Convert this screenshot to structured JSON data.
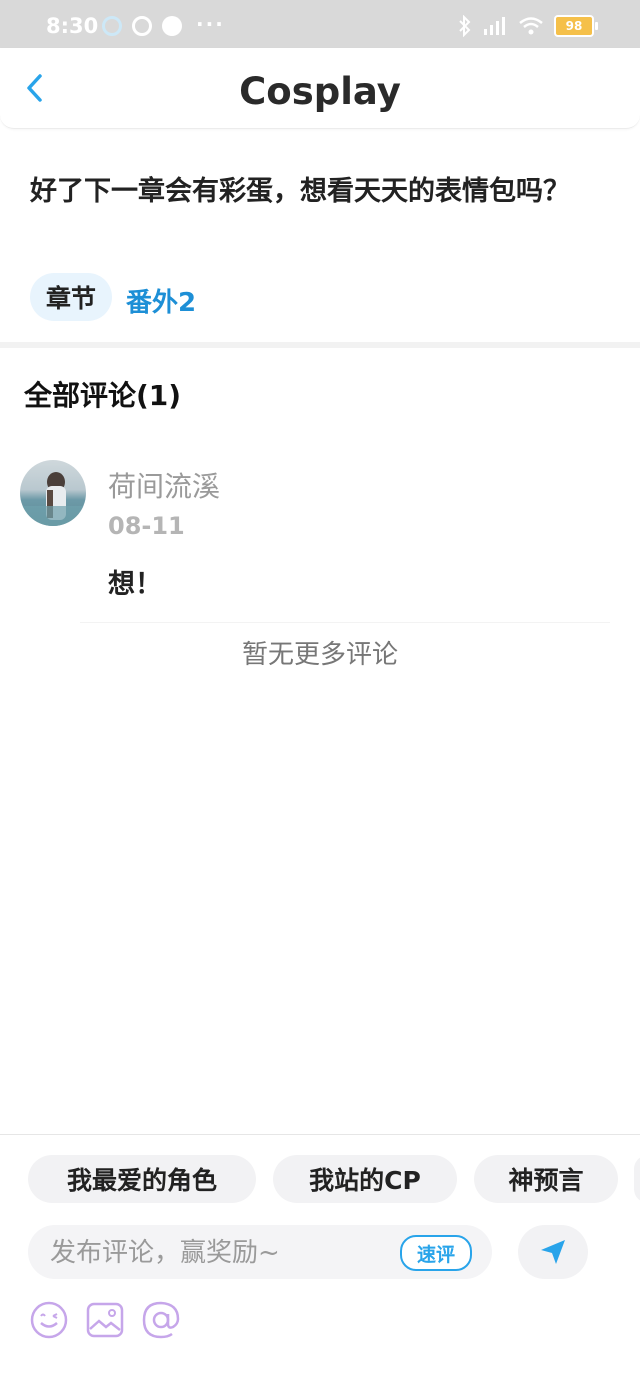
{
  "status_bar": {
    "time": "8:30",
    "dots": "···",
    "battery": "98"
  },
  "header": {
    "title": "Cosplay"
  },
  "post": {
    "text": "好了下一章会有彩蛋，想看天天的表情包吗？",
    "tag_label": "章节",
    "chapter_name": "番外2"
  },
  "comments": {
    "title": "全部评论(1)",
    "items": [
      {
        "author": "荷间流溪",
        "date": "08-11",
        "text": "想！"
      }
    ],
    "no_more": "暂无更多评论"
  },
  "bottom_bar": {
    "chips": [
      "我最爱的角色",
      "我站的CP",
      "神预言"
    ],
    "input_placeholder": "发布评论，赢奖励~",
    "quick_label": "速评"
  },
  "colors": {
    "accent": "#29a4ea",
    "chapter_link": "#1d8fd6",
    "tool_icon": "#c6a6ea"
  },
  "icons": [
    "back-arrow-icon",
    "send-icon",
    "emoji-icon",
    "image-icon",
    "at-icon",
    "bluetooth-icon",
    "signal-icon",
    "wifi-icon",
    "battery-icon"
  ]
}
